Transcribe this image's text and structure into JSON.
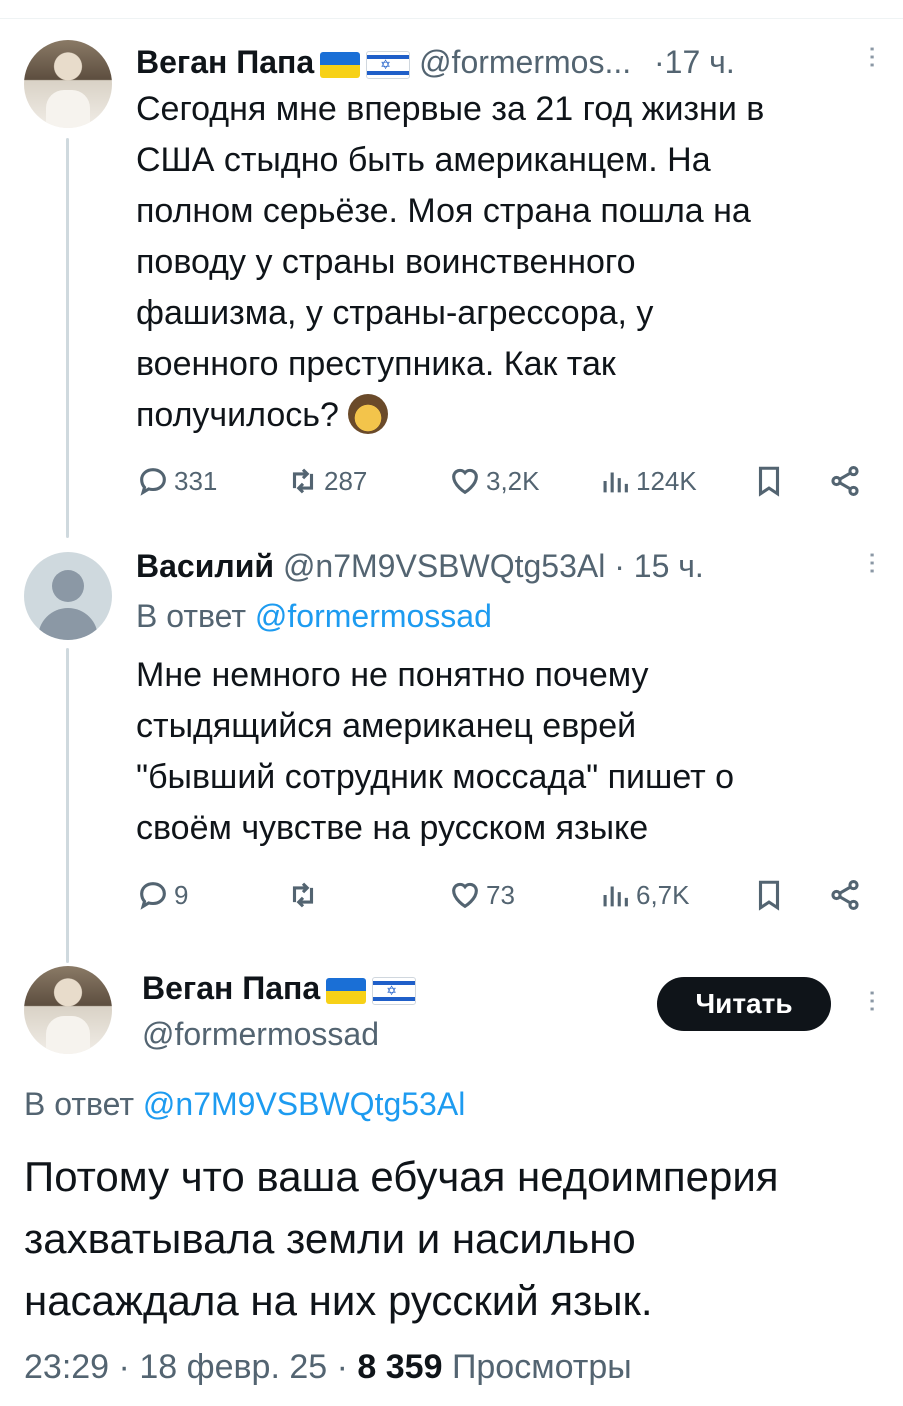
{
  "tweet1": {
    "name": "Веган Папа",
    "handle": "@formermos...",
    "sep": "·",
    "time": "17 ч.",
    "text_lines": [
      "Сегодня мне впервые за 21 год жизни в",
      "США стыдно быть американцем. На",
      "полном серьёзе. Моя страна пошла на",
      "поводу у страны воинственного",
      "фашизма, у страны-агрессора, у",
      "военного преступника. Как так",
      "получилось?"
    ],
    "replies": "331",
    "retweets": "287",
    "likes": "3,2K",
    "views": "124K"
  },
  "tweet2": {
    "name": "Василий",
    "handle": "@n7M9VSBWQtg53Al",
    "sep": "·",
    "time": "15 ч.",
    "reply_prefix": "В ответ",
    "reply_handle": "@formermossad",
    "text_lines": [
      "Мне немного не понятно почему",
      "стыдящийся американец еврей",
      "\"бывший сотрудник моссада\" пишет о",
      "своём чувстве на русском языке"
    ],
    "replies": "9",
    "retweets": "",
    "likes": "73",
    "views": "6,7K"
  },
  "tweet3": {
    "name": "Веган Папа",
    "handle": "@formermossad",
    "follow_label": "Читать",
    "reply_prefix": "В ответ",
    "reply_handle": "@n7M9VSBWQtg53Al",
    "text_lines": [
      "Потому что ваша ебучая недоимперия",
      "захватывала земли и насильно",
      "насаждала на них русский язык."
    ],
    "time": "23:29",
    "date": "18 февр. 25",
    "views_count": "8 359",
    "views_label": "Просмотры"
  },
  "colors": {
    "link": "#1d9bf0",
    "muted": "#536471",
    "text": "#0f1419",
    "button": "#0f1419"
  },
  "icons": [
    "reply-icon",
    "retweet-icon",
    "like-icon",
    "views-icon",
    "bookmark-icon",
    "share-icon",
    "more-icon"
  ]
}
